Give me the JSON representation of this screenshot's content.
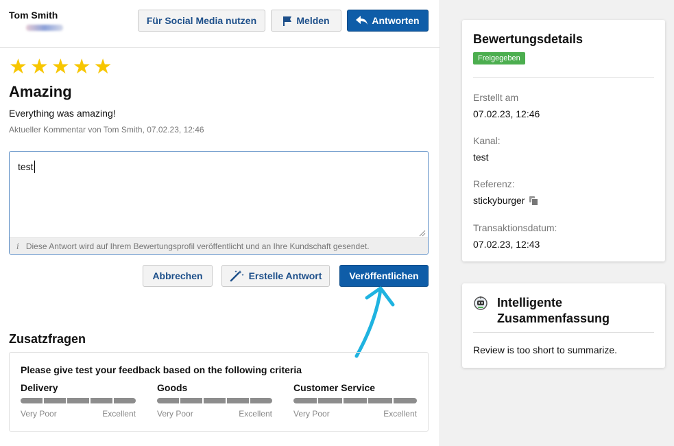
{
  "review": {
    "author": "Tom Smith",
    "rating": 5,
    "title": "Amazing",
    "text": "Everything was amazing!",
    "meta": "Aktueller Kommentar von Tom Smith, 07.02.23, 12:46"
  },
  "toolbar": {
    "social_label": "Für Social Media nutzen",
    "report_label": "Melden",
    "reply_label": "Antworten"
  },
  "reply": {
    "value": "test",
    "hint": "Diese Antwort wird auf Ihrem Bewertungsprofil veröffentlicht und an Ihre Kundschaft gesendet.",
    "cancel_label": "Abbrechen",
    "generate_label": "Erstelle Antwort",
    "publish_label": "Veröffentlichen"
  },
  "questions": {
    "title": "Zusatzfragen",
    "prompt": "Please give test your feedback based on the following criteria",
    "criteria": [
      {
        "name": "Delivery",
        "min": "Very Poor",
        "max": "Excellent"
      },
      {
        "name": "Goods",
        "min": "Very Poor",
        "max": "Excellent"
      },
      {
        "name": "Customer Service",
        "min": "Very Poor",
        "max": "Excellent"
      }
    ]
  },
  "details": {
    "title": "Bewertungsdetails",
    "status": "Freigegeben",
    "created_label": "Erstellt am",
    "created_value": "07.02.23, 12:46",
    "channel_label": "Kanal:",
    "channel_value": "test",
    "reference_label": "Referenz:",
    "reference_value": "stickyburger",
    "transaction_label": "Transaktionsdatum:",
    "transaction_value": "07.02.23, 12:43"
  },
  "summary": {
    "title_line1": "Intelligente",
    "title_line2": "Zusammenfassung",
    "text": "Review is too short to summarize."
  },
  "colors": {
    "primary": "#0f5da8",
    "star": "#f7c600",
    "status_green": "#4cae4f",
    "arrow": "#1fb3e0"
  }
}
